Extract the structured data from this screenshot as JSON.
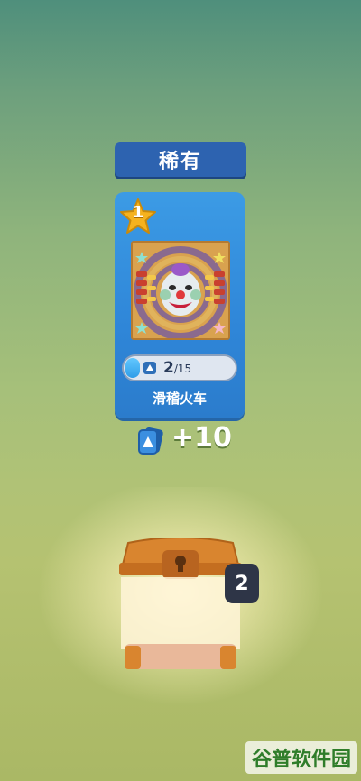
{
  "rarity": {
    "label": "稀有"
  },
  "card": {
    "level": "1",
    "name": "滑稽火车",
    "progress": {
      "current": "2",
      "total": "/15",
      "fraction": 0.13
    }
  },
  "reward": {
    "amount": "+10"
  },
  "chest": {
    "count": "2"
  },
  "watermark": {
    "text": "谷普软件园"
  },
  "colors": {
    "banner": "#2d63b0",
    "card": "#3290dd",
    "star": "#f5b21e",
    "chest_lid": "#d9852f"
  }
}
